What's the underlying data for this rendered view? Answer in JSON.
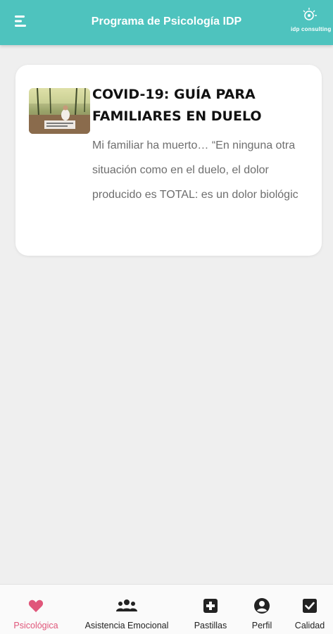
{
  "header": {
    "title": "Programa de Psicología IDP",
    "logo_text": "idp consulting"
  },
  "colors": {
    "header_bg": "#4ec3be",
    "active": "#e0567a",
    "inactive": "#222222"
  },
  "articles": [
    {
      "title": "COVID-19: GUÍA PARA FAMILIARES EN DUELO",
      "excerpt": "Mi familiar ha muerto… “En ninguna otra situación como en el duelo, el dolor producido es TOTAL: es un dolor biológic",
      "thumbnail_icon": "grief-photo-thumbnail"
    }
  ],
  "bottom_nav": {
    "items": [
      {
        "label": "Psicológica",
        "icon": "heart-icon",
        "active": true
      },
      {
        "label": "Asistencia Emocional",
        "icon": "group-icon",
        "active": false
      },
      {
        "label": "Pastillas",
        "icon": "plus-box-icon",
        "active": false
      },
      {
        "label": "Perfil",
        "icon": "user-circle-icon",
        "active": false
      },
      {
        "label": "Calidad",
        "icon": "checkbox-icon",
        "active": false
      }
    ]
  }
}
